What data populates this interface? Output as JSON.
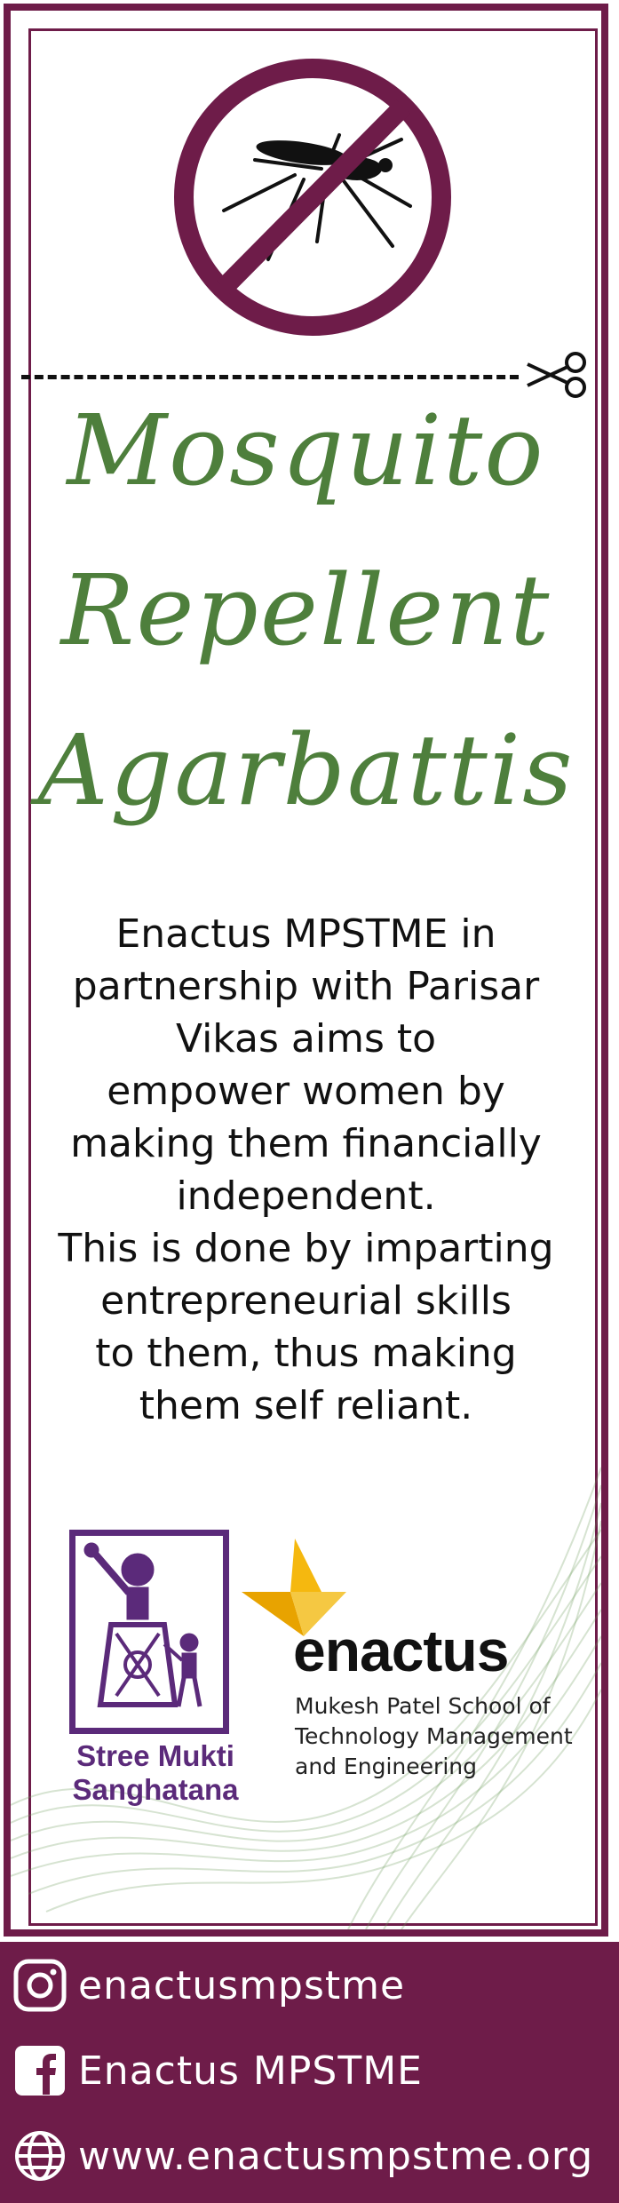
{
  "title": {
    "line1": "Mosquito",
    "line2": "Repellent",
    "line3": "Agarbattis"
  },
  "description": {
    "lines": [
      "Enactus MPSTME in",
      "partnership with Parisar",
      "Vikas aims to",
      "empower women by",
      "making them financially",
      "independent.",
      "This is done by imparting",
      "entrepreneurial skills",
      "to them, thus making",
      "them self reliant."
    ]
  },
  "logos": {
    "stree_mukti": {
      "line1": "Stree Mukti",
      "line2": "Sanghatana"
    },
    "enactus": {
      "wordmark": "enactus",
      "sub1": "Mukesh Patel School of",
      "sub2": "Technology Management",
      "sub3": "and Engineering"
    }
  },
  "social": {
    "instagram": "enactusmpstme",
    "facebook": "Enactus MPSTME",
    "website": "www.enactusmpstme.org"
  },
  "colors": {
    "brand_maroon": "#6e1c49",
    "title_green": "#4e7f3c",
    "smk_purple": "#5b2a7a",
    "enactus_yellow": "#f5b80f"
  },
  "icons": {
    "sign": "no-mosquito-icon",
    "cut": "scissors-icon",
    "instagram": "instagram-icon",
    "facebook": "facebook-icon",
    "website": "globe-icon"
  }
}
